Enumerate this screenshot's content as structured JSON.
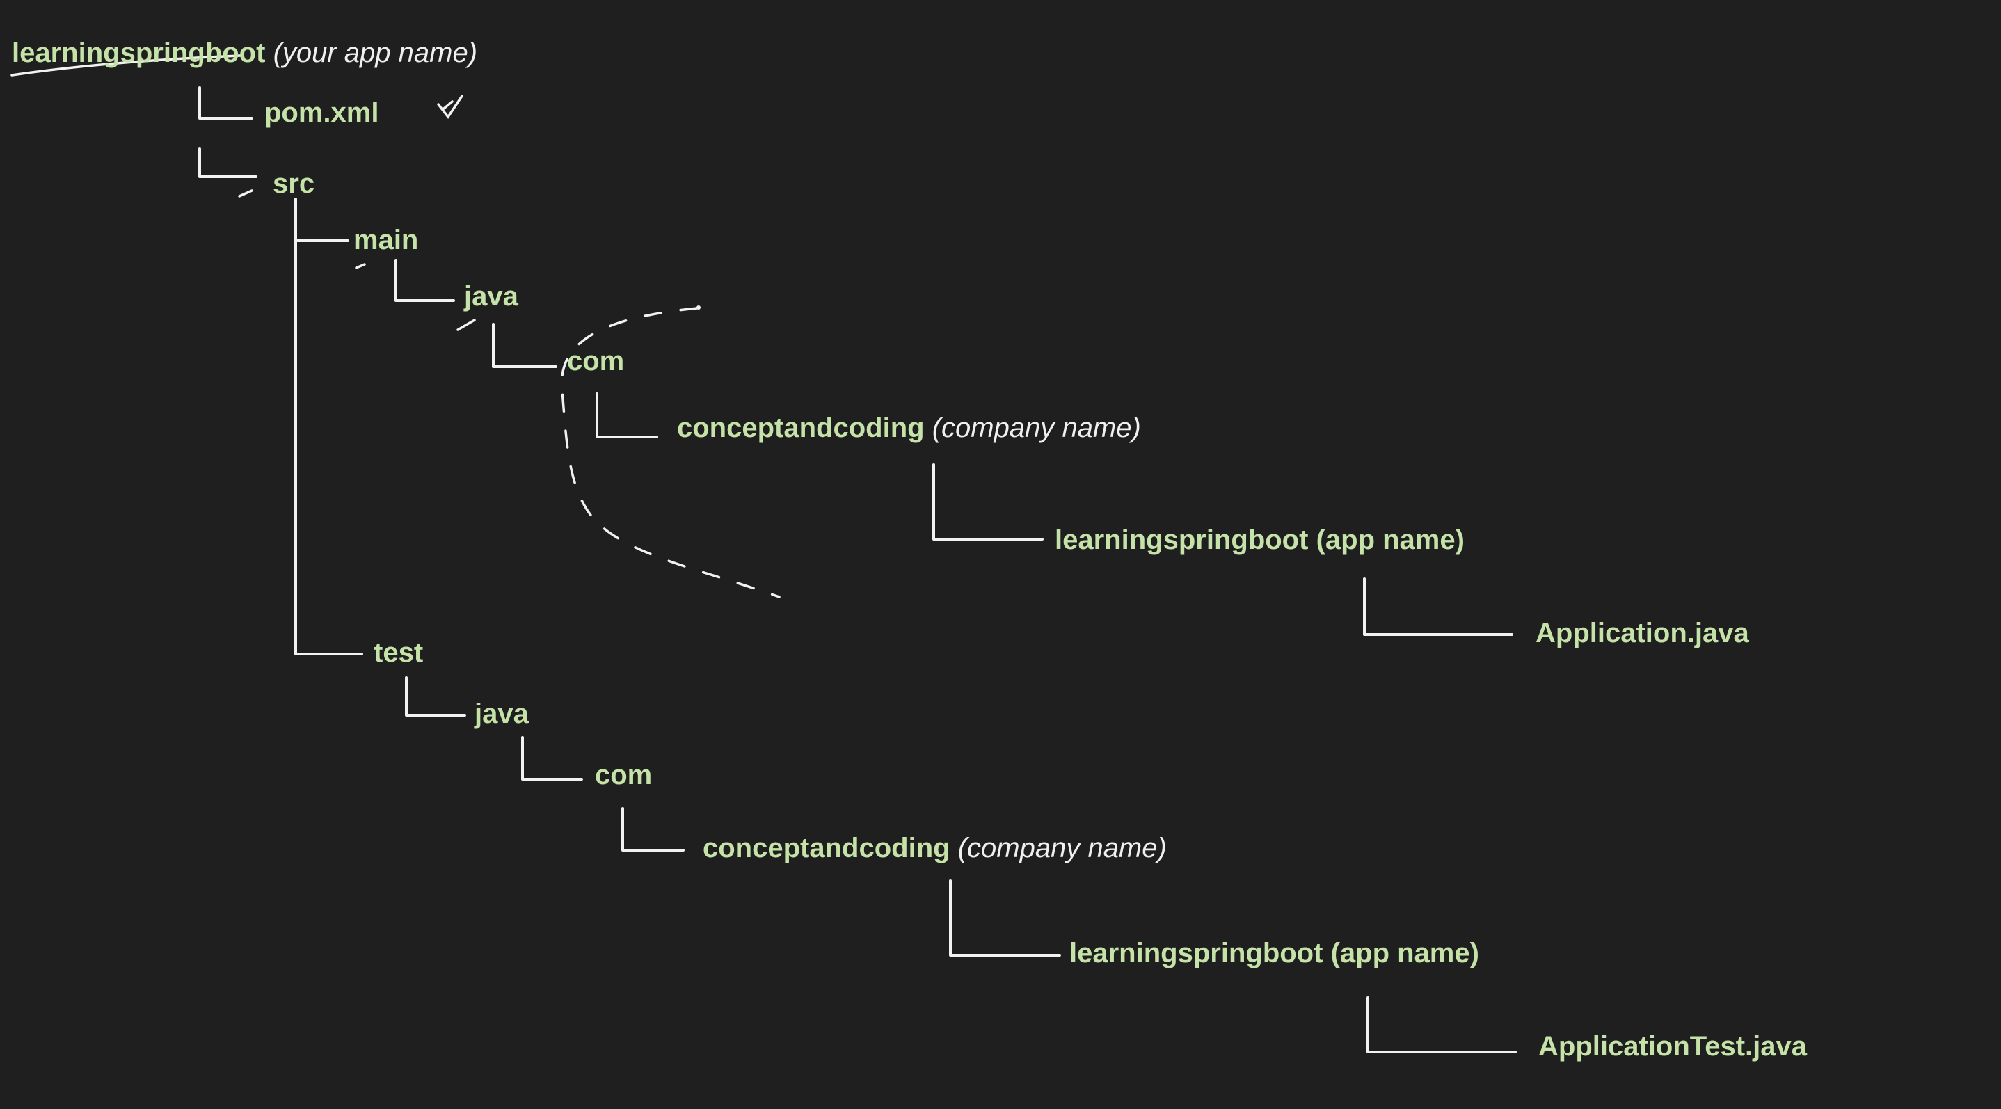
{
  "tree": {
    "root": {
      "name": "learningspringboot",
      "note": "(your app name)"
    },
    "pom": {
      "name": "pom.xml"
    },
    "src": {
      "name": "src"
    },
    "main": {
      "name": "main"
    },
    "main_java": {
      "name": "java"
    },
    "main_com": {
      "name": "com"
    },
    "main_company": {
      "name": "conceptandcoding",
      "note": "(company name)"
    },
    "main_app": {
      "name": "learningspringboot",
      "note": "(app name)"
    },
    "main_file": {
      "name": "Application.java"
    },
    "test": {
      "name": "test"
    },
    "test_java": {
      "name": "java"
    },
    "test_com": {
      "name": "com"
    },
    "test_company": {
      "name": "conceptandcoding",
      "note": "(company name)"
    },
    "test_app": {
      "name": "learningspringboot",
      "note": "(app name)"
    },
    "test_file": {
      "name": "ApplicationTest.java"
    }
  },
  "annotations": {
    "pom_mark": "checkmark-icon"
  },
  "colors": {
    "background": "#1f1f1f",
    "node_text": "#c5e2a9",
    "note_text": "#f0f0f0",
    "lines": "#f2f2f2"
  }
}
